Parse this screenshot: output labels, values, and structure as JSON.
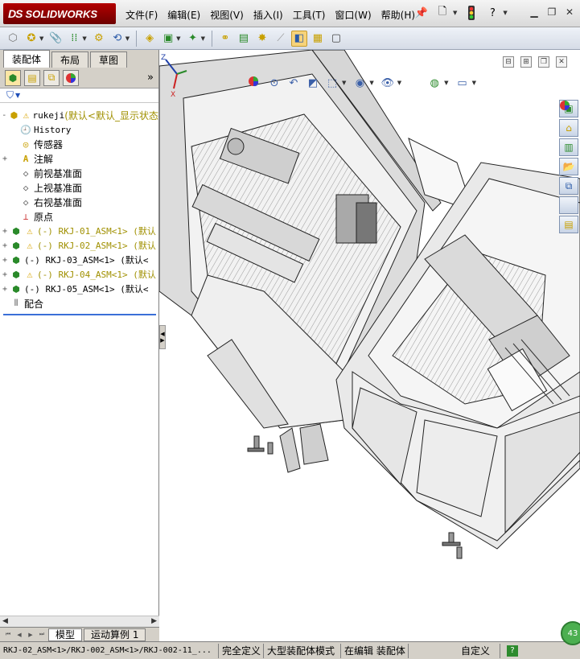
{
  "app": {
    "brand": "SOLIDWORKS",
    "brand_prefix": "DS"
  },
  "menu": [
    "文件(F)",
    "编辑(E)",
    "视图(V)",
    "插入(I)",
    "工具(T)",
    "窗口(W)",
    "帮助(H)"
  ],
  "title_icons": [
    "pin-icon",
    "new-document-icon",
    "traffic-light-icon",
    "help-icon"
  ],
  "window_controls": [
    "minimize-icon",
    "restore-icon",
    "close-icon"
  ],
  "feature_manager": {
    "tabs": [
      "装配体",
      "布局",
      "草图"
    ],
    "active_tab": 0,
    "more_glyph": "»",
    "filter_glyph": "▼",
    "tree": [
      {
        "label": "rukeji",
        "suffix": " (默认<默认_显示状态",
        "icon": "assembly-icon",
        "warn": true,
        "expand": "-",
        "olive": false,
        "indent": 0
      },
      {
        "label": "History",
        "icon": "history-icon",
        "warn": false,
        "expand": "",
        "indent": 1
      },
      {
        "label": "传感器",
        "icon": "sensor-icon",
        "warn": false,
        "expand": "",
        "indent": 1
      },
      {
        "label": "注解",
        "icon": "annotation-icon",
        "warn": false,
        "expand": "+",
        "indent": 1
      },
      {
        "label": "前视基准面",
        "icon": "plane-icon",
        "warn": false,
        "expand": "",
        "indent": 1
      },
      {
        "label": "上视基准面",
        "icon": "plane-icon",
        "warn": false,
        "expand": "",
        "indent": 1
      },
      {
        "label": "右视基准面",
        "icon": "plane-icon",
        "warn": false,
        "expand": "",
        "indent": 1
      },
      {
        "label": "原点",
        "icon": "origin-icon",
        "warn": false,
        "expand": "",
        "indent": 1
      },
      {
        "label": "(-) RKJ-01_ASM<1> (默认",
        "icon": "subassembly-icon",
        "warn": true,
        "expand": "+",
        "olive": true,
        "indent": 0
      },
      {
        "label": "(-) RKJ-02_ASM<1> (默认",
        "icon": "subassembly-icon",
        "warn": true,
        "expand": "+",
        "olive": true,
        "indent": 0
      },
      {
        "label": "(-) RKJ-03_ASM<1> (默认<",
        "icon": "subassembly-icon",
        "warn": false,
        "expand": "+",
        "olive": false,
        "indent": 0
      },
      {
        "label": "(-) RKJ-04_ASM<1> (默认",
        "icon": "subassembly-icon",
        "warn": true,
        "expand": "+",
        "olive": true,
        "indent": 0
      },
      {
        "label": "(-) RKJ-05_ASM<1> (默认<",
        "icon": "subassembly-icon",
        "warn": false,
        "expand": "+",
        "olive": false,
        "indent": 0
      },
      {
        "label": "配合",
        "icon": "mates-icon",
        "warn": false,
        "expand": "",
        "indent": 0
      }
    ],
    "bottom_tabs": [
      "模型",
      "运动算例 1"
    ]
  },
  "status": {
    "path": "RKJ-02_ASM<1>/RKJ-002_ASM<1>/RKJ-002-11_...",
    "definition": "完全定义",
    "mode": "大型装配体模式",
    "editing": "在编辑 装配体",
    "units": "自定义",
    "help": "?"
  },
  "viewport": {
    "triad_z": "Z",
    "triad_y": "Y",
    "triad_x": "X",
    "badge": "43"
  }
}
